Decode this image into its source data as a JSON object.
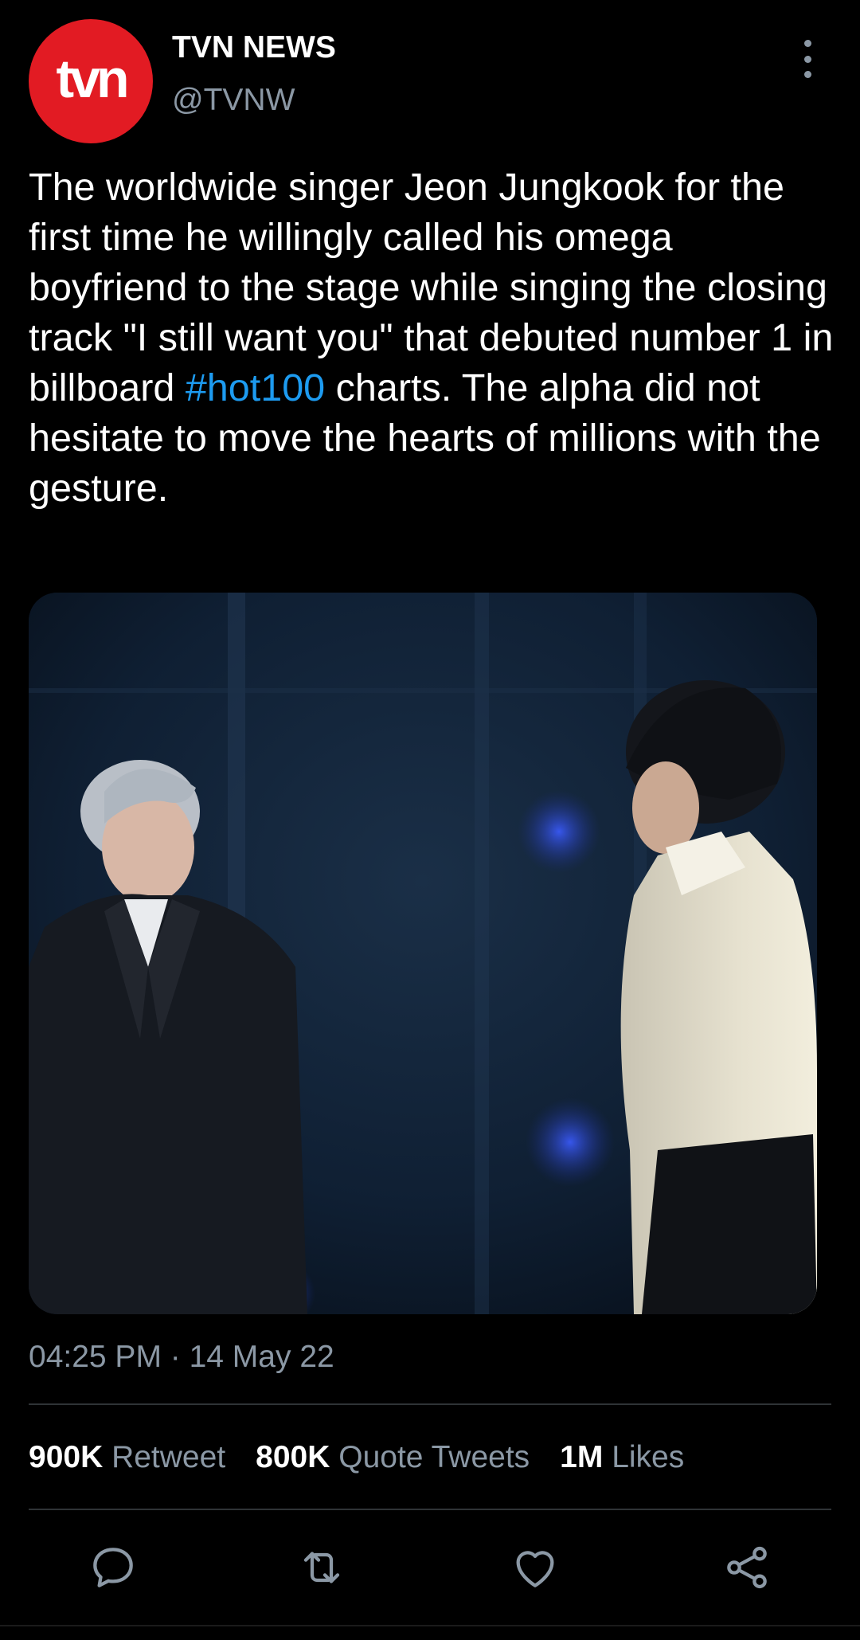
{
  "author": {
    "avatar_text": "tvn",
    "display_name": "TVN NEWS",
    "handle": "@TVNW",
    "avatar_color": "#e21b23"
  },
  "tweet": {
    "text_before": "The worldwide singer Jeon Jungkook for the first time he willingly called his omega boyfriend to the stage while singing the closing track \"I still want you\" that debuted number 1 in billboard ",
    "hashtag": "#hot100",
    "text_after": " charts. The alpha did not hesitate to move the hearts of millions with the gesture.",
    "timestamp": "04:25 PM · 14 May 22"
  },
  "stats": {
    "retweets_count": "900K",
    "retweets_label": "Retweet",
    "quotes_count": "800K",
    "quotes_label": "Quote Tweets",
    "likes_count": "1M",
    "likes_label": "Likes"
  },
  "icons": {
    "more": "more-vertical-icon",
    "reply": "reply-bubble-icon",
    "retweet": "retweet-icon",
    "like": "heart-icon",
    "share": "share-icon"
  },
  "colors": {
    "background": "#000000",
    "text": "#ffffff",
    "secondary": "#8b98a5",
    "link": "#1d9bf0",
    "divider": "#2f3336"
  }
}
